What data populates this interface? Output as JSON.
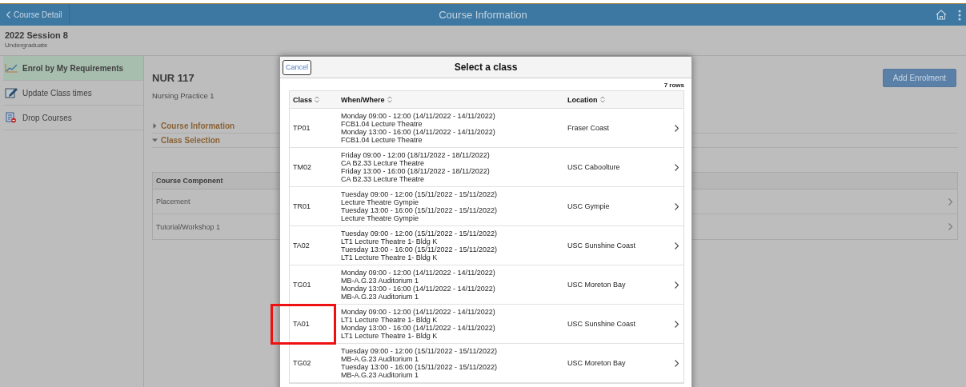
{
  "header": {
    "back_label": "Course Detail",
    "title": "Course Information"
  },
  "term": {
    "title": "2022 Session 8",
    "career": "Undergraduate"
  },
  "sidebar": {
    "items": [
      {
        "label": "Enrol by My Requirements",
        "selected": true,
        "kind": "chart"
      },
      {
        "label": "Update Class times",
        "selected": false,
        "kind": "edit"
      },
      {
        "label": "Drop Courses",
        "selected": false,
        "kind": "drop"
      }
    ]
  },
  "course": {
    "code": "NUR 117",
    "name": "Nursing Practice 1",
    "add_button": "Add Enrolment",
    "sections": [
      {
        "label": "Course Information",
        "expanded": false
      },
      {
        "label": "Class Selection",
        "expanded": true
      }
    ],
    "components": {
      "heading": "Course Component",
      "rows": [
        "Placement",
        "Tutorial/Workshop 1"
      ]
    }
  },
  "modal": {
    "cancel": "Cancel",
    "title": "Select a class",
    "row_count": "7 rows",
    "columns": [
      "Class",
      "When/Where",
      "Location"
    ],
    "rows": [
      {
        "class": "TP01",
        "when_where": [
          "Monday 09:00 - 12:00 (14/11/2022 - 14/11/2022)",
          "FCB1.04 Lecture Theatre",
          "Monday 13:00 - 16:00 (14/11/2022 - 14/11/2022)",
          "FCB1.04 Lecture Theatre"
        ],
        "location": "Fraser Coast",
        "highlighted": false
      },
      {
        "class": "TM02",
        "when_where": [
          "Friday 09:00 - 12:00 (18/11/2022 - 18/11/2022)",
          "CA B2.33 Lecture Theatre",
          "Friday 13:00 - 16:00 (18/11/2022 - 18/11/2022)",
          "CA B2.33 Lecture Theatre"
        ],
        "location": "USC Caboolture",
        "highlighted": false
      },
      {
        "class": "TR01",
        "when_where": [
          "Tuesday 09:00 - 12:00 (15/11/2022 - 15/11/2022)",
          "Lecture Theatre Gympie",
          "Tuesday 13:00 - 16:00 (15/11/2022 - 15/11/2022)",
          "Lecture Theatre Gympie"
        ],
        "location": "USC Gympie",
        "highlighted": false
      },
      {
        "class": "TA02",
        "when_where": [
          "Tuesday 09:00 - 12:00 (15/11/2022 - 15/11/2022)",
          "LT1 Lecture Theatre 1- Bldg K",
          "Tuesday 13:00 - 16:00 (15/11/2022 - 15/11/2022)",
          "LT1 Lecture Theatre 1- Bldg K"
        ],
        "location": "USC Sunshine Coast",
        "highlighted": false
      },
      {
        "class": "TG01",
        "when_where": [
          "Monday 09:00 - 12:00 (14/11/2022 - 14/11/2022)",
          "MB-A.G.23 Auditorium 1",
          "Monday 13:00 - 16:00 (14/11/2022 - 14/11/2022)",
          "MB-A.G.23 Auditorium 1"
        ],
        "location": "USC Moreton Bay",
        "highlighted": false
      },
      {
        "class": "TA01",
        "when_where": [
          "Monday 09:00 - 12:00 (14/11/2022 - 14/11/2022)",
          "LT1 Lecture Theatre 1- Bldg K",
          "Monday 13:00 - 16:00 (14/11/2022 - 14/11/2022)",
          "LT1 Lecture Theatre 1- Bldg K"
        ],
        "location": "USC Sunshine Coast",
        "highlighted": true
      },
      {
        "class": "TG02",
        "when_where": [
          "Tuesday 09:00 - 12:00 (15/11/2022 - 15/11/2022)",
          "MB-A.G.23 Auditorium 1",
          "Tuesday 13:00 - 16:00 (15/11/2022 - 15/11/2022)",
          "MB-A.G.23 Auditorium 1"
        ],
        "location": "USC Moreton Bay",
        "highlighted": false
      }
    ]
  }
}
